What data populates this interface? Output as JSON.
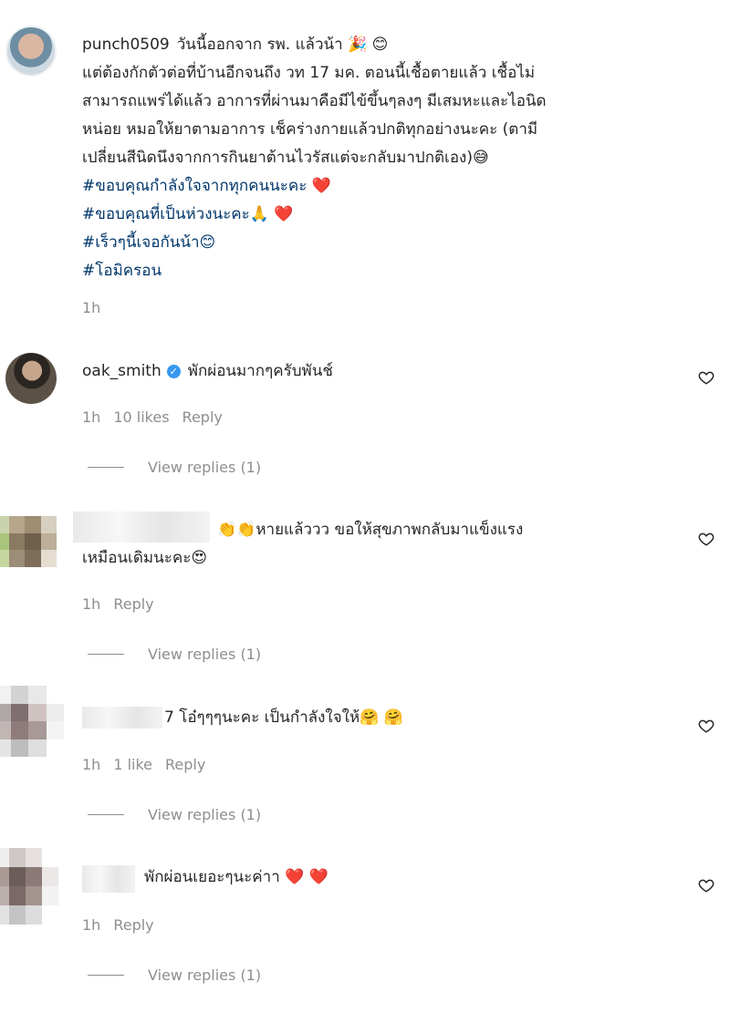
{
  "post": {
    "username": "punch0509",
    "lines": [
      "วันนี้ออกจาก รพ. แล้วน้า 🎉 😊",
      "แต่ต้องกักตัวต่อที่บ้านอีกจนถึง วท 17 มค. ตอนนี้เชื้อตายแล้ว เชื้อไม่",
      "สามารถแพร่ได้แล้ว อาการที่ผ่านมาคือมีไข้ขึ้นๆลงๆ มีเสมหะและไอนิด",
      "หน่อย หมอให้ยาตามอาการ เช็คร่างกายแล้วปกติทุกอย่างนะคะ (ตามี",
      "เปลี่ยนสีนิดนึงจากการกินยาต้านไวรัสแต่จะกลับมาปกติเอง)😅"
    ],
    "hashtags": [
      "#ขอบคุณกำลังใจจากทุกคนนะคะ ❤️",
      "#ขอบคุณที่เป็นห่วงนะคะ🙏 ❤️",
      "#เร็วๆนี้เจอกันน้า😊",
      "#โอมิครอน"
    ],
    "time": "1h"
  },
  "comments": [
    {
      "username": "oak_smith",
      "verified_icon": "check",
      "lines": [
        "พักผ่อนมากๆครับพันช์"
      ],
      "time": "1h",
      "likes": "10 likes",
      "reply": "Reply",
      "view_replies": "View replies (1)"
    },
    {
      "username": "",
      "lines": [
        "👏👏หายแล้ววว ขอให้สุขภาพกลับมาแข็งแรง",
        "เหมือนเดิมนะคะ😍"
      ],
      "time": "1h",
      "likes": "",
      "reply": "Reply",
      "view_replies": "View replies (1)"
    },
    {
      "username": "",
      "lines": [
        "7 โอ๋ๆๆๆนะคะ เป็นกำลังใจให้🤗 🤗"
      ],
      "time": "1h",
      "likes": "1 like",
      "reply": "Reply",
      "view_replies": "View replies (1)"
    },
    {
      "username": "",
      "lines": [
        "พักผ่อนเยอะๆนะค่าา ❤️ ❤️"
      ],
      "time": "1h",
      "likes": "",
      "reply": "Reply",
      "view_replies": "View replies (1)"
    }
  ],
  "icons": {
    "like": "heart-outline-icon",
    "verified": "verified-badge-icon"
  },
  "colors": {
    "text": "#262626",
    "meta": "#8e8e8e",
    "hashtag": "#00376b",
    "verified": "#3897f0"
  }
}
